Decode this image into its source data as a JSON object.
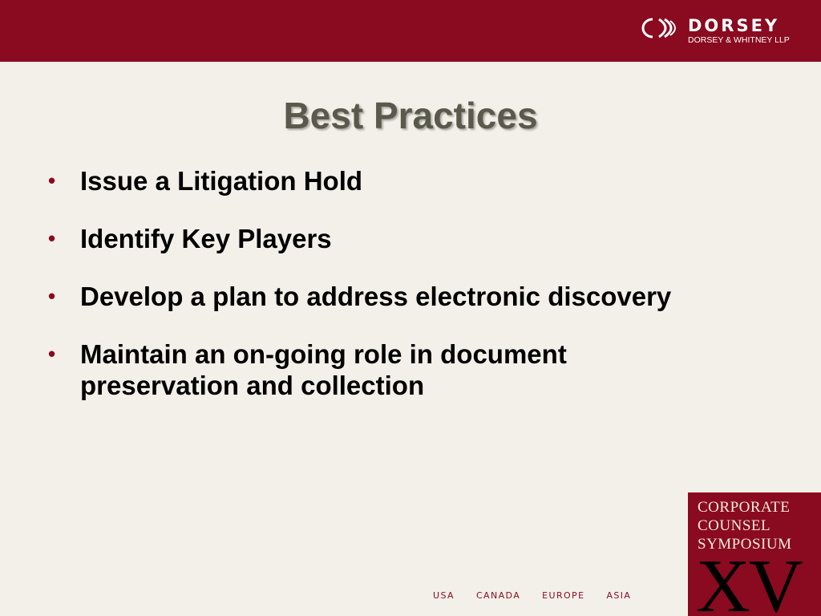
{
  "header": {
    "brand_color": "#8a0a1f",
    "logo": {
      "name": "DORSEY",
      "subtitle": "DORSEY & WHITNEY LLP",
      "icon": "dorsey-chevron-icon"
    }
  },
  "slide": {
    "title": "Best Practices",
    "bullets": [
      "Issue a Litigation Hold",
      "Identify Key Players",
      "Develop a plan to address electronic discovery",
      "Maintain an on-going role in document preservation and collection"
    ]
  },
  "footer": {
    "regions": [
      "USA",
      "CANADA",
      "EUROPE",
      "ASIA"
    ],
    "symposium": {
      "lines": [
        "CORPORATE",
        "COUNSEL",
        "SYMPOSIUM"
      ],
      "numeral": "XV"
    }
  }
}
